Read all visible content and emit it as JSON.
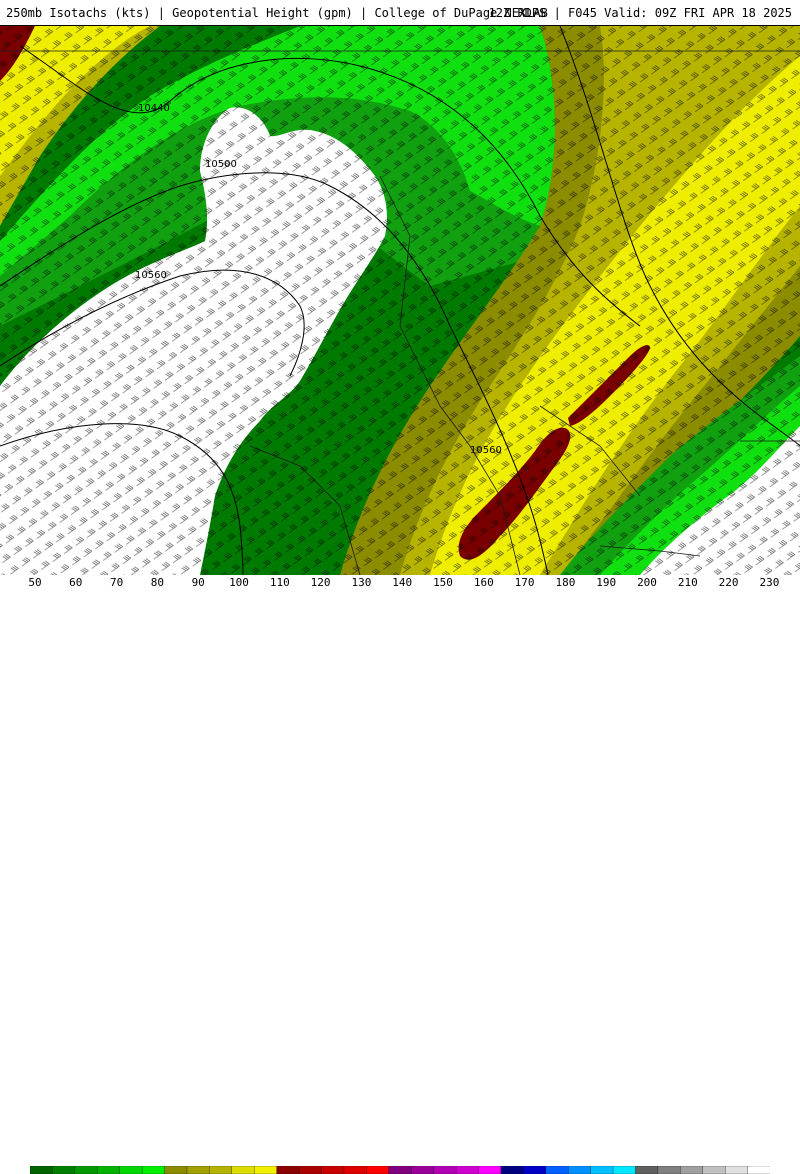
{
  "header": {
    "title_left": "250mb Isotachs (kts) | Geopotential Height (gpm) | College of DuPage NEXLAB",
    "title_right": "12Z RDPS | F045 Valid: 09Z FRI APR 18 2025"
  },
  "map": {
    "contour_labels": [
      "10440",
      "10500",
      "10560",
      "10560"
    ],
    "colors": {
      "calm": "#ffffff",
      "green_dark": "#007a00",
      "green_mid": "#10a010",
      "green_bright": "#10e010",
      "olive": "#8c8c00",
      "yellow_olive": "#b7b400",
      "yellow": "#f0ee00",
      "maroon": "#7a0000"
    }
  },
  "legend": {
    "labels": [
      "50",
      "60",
      "70",
      "80",
      "90",
      "100",
      "110",
      "120",
      "130",
      "140",
      "150",
      "160",
      "170",
      "180",
      "190",
      "200",
      "210",
      "220",
      "230"
    ],
    "colors": [
      "#006400",
      "#008000",
      "#009a00",
      "#00b400",
      "#00d800",
      "#00f000",
      "#8c8c00",
      "#a0a000",
      "#b4b400",
      "#dcdc00",
      "#f0f000",
      "#8b0000",
      "#aa0000",
      "#c80000",
      "#e00000",
      "#ff0000",
      "#800080",
      "#9b009b",
      "#b400b4",
      "#d000d0",
      "#ff00ff",
      "#000080",
      "#0000c8",
      "#0060ff",
      "#0090ff",
      "#00c0ff",
      "#00e8ff",
      "#606060",
      "#808080",
      "#a0a0a0",
      "#c0c0c0",
      "#e0e0e0",
      "#ffffff"
    ]
  }
}
